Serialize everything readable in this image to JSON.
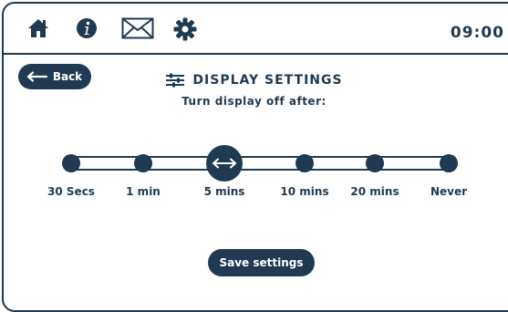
{
  "header": {
    "clock": "09:00",
    "icons": [
      "home-icon",
      "info-icon",
      "mail-icon",
      "gear-icon"
    ]
  },
  "back_button": {
    "label": "Back"
  },
  "page": {
    "title": "DISPLAY SETTINGS",
    "subtitle": "Turn display off after:"
  },
  "slider": {
    "options": [
      "30 Secs",
      "1 min",
      "5 mins",
      "10 mins",
      "20 mins",
      "Never"
    ],
    "selected": "5 mins"
  },
  "save_button": {
    "label": "Save settings"
  },
  "colors": {
    "primary": "#1f3a52",
    "background": "#ffffff"
  }
}
